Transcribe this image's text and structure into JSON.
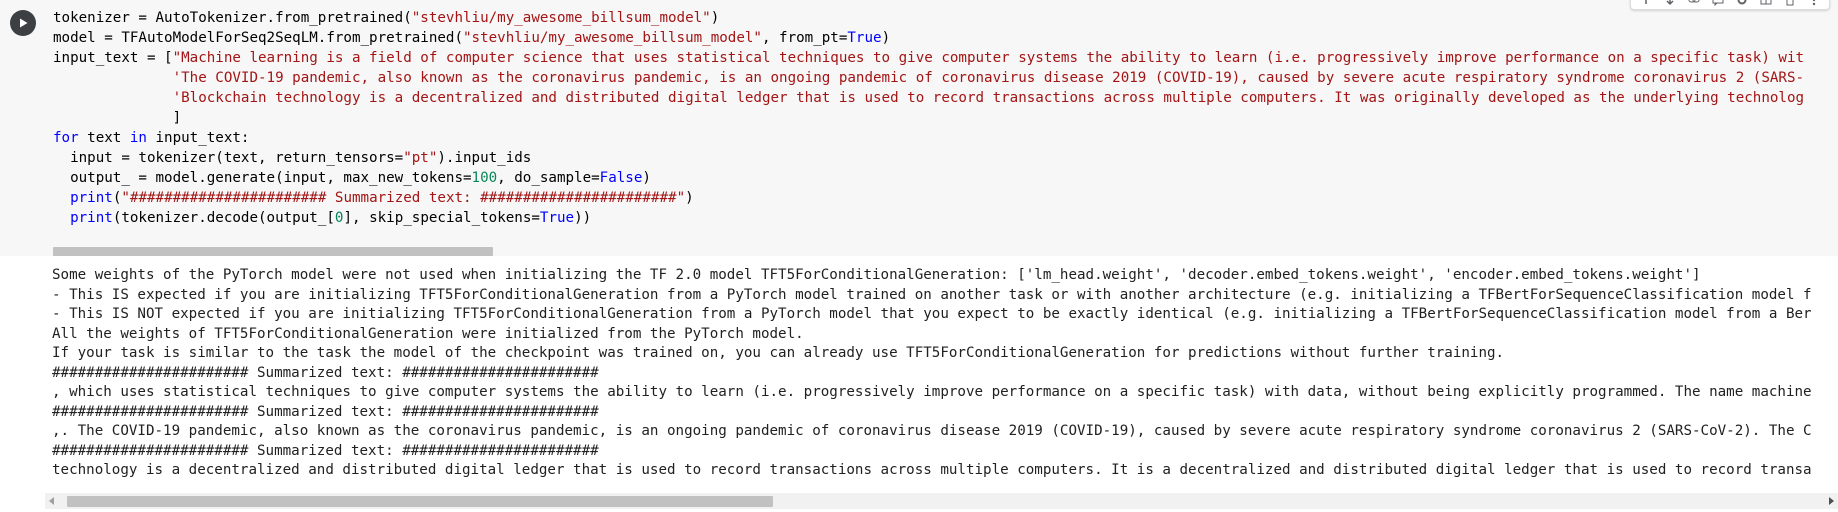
{
  "code_cell": {
    "lines": [
      [
        {
          "t": "tokenizer = AutoTokenizer.from_pretrained(",
          "c": ""
        },
        {
          "t": "\"stevhliu/my_awesome_billsum_model\"",
          "c": "str"
        },
        {
          "t": ")",
          "c": ""
        }
      ],
      [
        {
          "t": "model = TFAutoModelForSeq2SeqLM.from_pretrained(",
          "c": ""
        },
        {
          "t": "\"stevhliu/my_awesome_billsum_model\"",
          "c": "str"
        },
        {
          "t": ", from_pt=",
          "c": ""
        },
        {
          "t": "True",
          "c": "bool"
        },
        {
          "t": ")",
          "c": ""
        }
      ],
      [
        {
          "t": "input_text = [",
          "c": ""
        },
        {
          "t": "\"Machine learning is a field of computer science that uses statistical techniques to give computer systems the ability to learn (i.e. progressively improve performance on a specific task) wit",
          "c": "str"
        }
      ],
      [
        {
          "t": "              ",
          "c": ""
        },
        {
          "t": "'The COVID-19 pandemic, also known as the coronavirus pandemic, is an ongoing pandemic of coronavirus disease 2019 (COVID-19), caused by severe acute respiratory syndrome coronavirus 2 (SARS-",
          "c": "str"
        }
      ],
      [
        {
          "t": "              ",
          "c": ""
        },
        {
          "t": "'Blockchain technology is a decentralized and distributed digital ledger that is used to record transactions across multiple computers. It was originally developed as the underlying technolog",
          "c": "str"
        }
      ],
      [
        {
          "t": "              ]",
          "c": ""
        }
      ],
      [
        {
          "t": "for",
          "c": "kw"
        },
        {
          "t": " text ",
          "c": ""
        },
        {
          "t": "in",
          "c": "kw"
        },
        {
          "t": " input_text:",
          "c": ""
        }
      ],
      [
        {
          "t": "  input = tokenizer(text, return_tensors=",
          "c": ""
        },
        {
          "t": "\"pt\"",
          "c": "str"
        },
        {
          "t": ").input_ids",
          "c": ""
        }
      ],
      [
        {
          "t": "  output_ = model.generate(input, max_new_tokens=",
          "c": ""
        },
        {
          "t": "100",
          "c": "num"
        },
        {
          "t": ", do_sample=",
          "c": ""
        },
        {
          "t": "False",
          "c": "bool"
        },
        {
          "t": ")",
          "c": ""
        }
      ],
      [
        {
          "t": "  ",
          "c": ""
        },
        {
          "t": "print",
          "c": "kw"
        },
        {
          "t": "(",
          "c": ""
        },
        {
          "t": "\"####################### Summarized text: #######################\"",
          "c": "str"
        },
        {
          "t": ")",
          "c": ""
        }
      ],
      [
        {
          "t": "  ",
          "c": ""
        },
        {
          "t": "print",
          "c": "kw"
        },
        {
          "t": "(tokenizer.decode(output_[",
          "c": ""
        },
        {
          "t": "0",
          "c": "num"
        },
        {
          "t": "], skip_special_tokens=",
          "c": ""
        },
        {
          "t": "True",
          "c": "bool"
        },
        {
          "t": "))",
          "c": ""
        }
      ]
    ]
  },
  "output": {
    "lines": [
      "Some weights of the PyTorch model were not used when initializing the TF 2.0 model TFT5ForConditionalGeneration: ['lm_head.weight', 'decoder.embed_tokens.weight', 'encoder.embed_tokens.weight']",
      "- This IS expected if you are initializing TFT5ForConditionalGeneration from a PyTorch model trained on another task or with another architecture (e.g. initializing a TFBertForSequenceClassification model f",
      "- This IS NOT expected if you are initializing TFT5ForConditionalGeneration from a PyTorch model that you expect to be exactly identical (e.g. initializing a TFBertForSequenceClassification model from a Ber",
      "All the weights of TFT5ForConditionalGeneration were initialized from the PyTorch model.",
      "If your task is similar to the task the model of the checkpoint was trained on, you can already use TFT5ForConditionalGeneration for predictions without further training.",
      "####################### Summarized text: #######################",
      ", which uses statistical techniques to give computer systems the ability to learn (i.e. progressively improve performance on a specific task) with data, without being explicitly programmed. The name machine",
      "####################### Summarized text: #######################",
      ",. The COVID-19 pandemic, also known as the coronavirus pandemic, is an ongoing pandemic of coronavirus disease 2019 (COVID-19), caused by severe acute respiratory syndrome coronavirus 2 (SARS-CoV-2). The C",
      "####################### Summarized text: #######################",
      "technology is a decentralized and distributed digital ledger that is used to record transactions across multiple computers. It is a decentralized and distributed digital ledger that is used to record transa"
    ]
  },
  "toolbar": {
    "icons": [
      "arrow-up-icon",
      "arrow-down-icon",
      "link-icon",
      "comment-icon",
      "settings-icon",
      "mirror-icon",
      "delete-icon",
      "more-icon"
    ]
  },
  "colors": {
    "code_background": "#f7f7f7",
    "string": "#a31515",
    "keyword": "#0000ff",
    "number": "#098658",
    "output_text": "#212121"
  }
}
